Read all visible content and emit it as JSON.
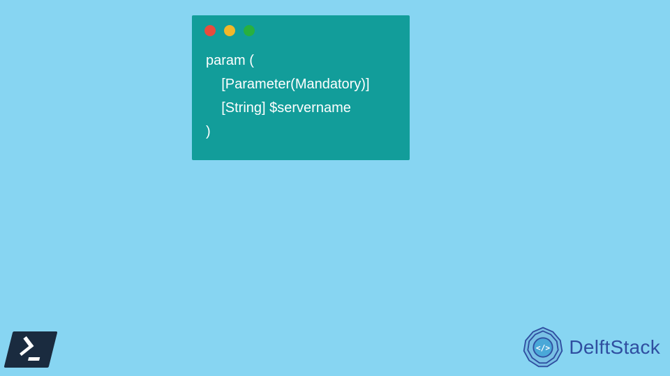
{
  "codeWindow": {
    "dots": [
      "red",
      "yellow",
      "green"
    ],
    "lines": [
      "param (",
      "    [Parameter(Mandatory)]",
      "    [String] $servername",
      ")"
    ]
  },
  "brand": {
    "name": "DelftStack",
    "logoColor": "#2f4ea0"
  },
  "icons": {
    "powershell": "powershell-icon"
  }
}
